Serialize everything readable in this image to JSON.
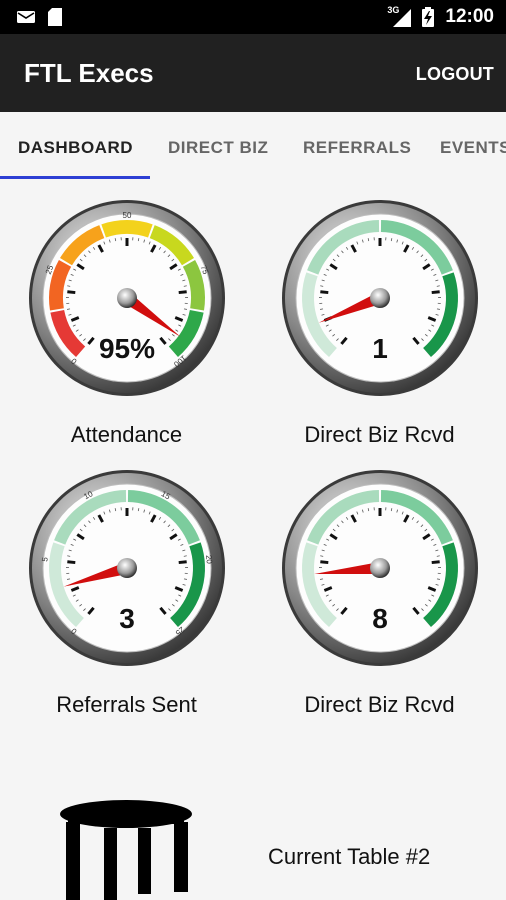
{
  "status_bar": {
    "time": "12:00",
    "network_label": "3G",
    "icons": [
      "email-icon",
      "sim-card-icon",
      "signal-icon",
      "battery-icon"
    ]
  },
  "app_bar": {
    "title": "FTL Execs",
    "logout_label": "LOGOUT"
  },
  "tabs": [
    {
      "label": "DASHBOARD",
      "active": true
    },
    {
      "label": "DIRECT BIZ",
      "active": false
    },
    {
      "label": "REFERRALS",
      "active": false
    },
    {
      "label": "EVENTS",
      "active": false
    }
  ],
  "gauges": [
    {
      "label": "Attendance",
      "value_text": "95%",
      "value": 95,
      "min": 0,
      "max": 100,
      "tick_labels": [
        "0",
        "25",
        "50",
        "75",
        "100"
      ],
      "scheme": "traffic",
      "colors": [
        "#e53935",
        "#f26522",
        "#f7a21b",
        "#f3d21c",
        "#c8d81e",
        "#8cc63f",
        "#2ea84a"
      ]
    },
    {
      "label": "Direct Biz Rcvd",
      "value_text": "1",
      "value": 1,
      "min": 0,
      "max": 10,
      "tick_labels": [],
      "scheme": "green",
      "colors": [
        "#cfe9d9",
        "#a9dbbd",
        "#7ccc9d",
        "#19964a"
      ]
    },
    {
      "label": "Referrals Sent",
      "value_text": "3",
      "value": 3,
      "min": 0,
      "max": 25,
      "tick_labels": [
        "0",
        "5",
        "10",
        "15",
        "20",
        "25"
      ],
      "scheme": "green",
      "colors": [
        "#cfe9d9",
        "#a9dbbd",
        "#7ccc9d",
        "#19964a"
      ]
    },
    {
      "label": "Direct Biz Rcvd",
      "value_text": "8",
      "value": 8,
      "min": 0,
      "max": 50,
      "tick_labels": [],
      "scheme": "green",
      "colors": [
        "#cfe9d9",
        "#a9dbbd",
        "#7ccc9d",
        "#19964a"
      ]
    }
  ],
  "current_table": {
    "label": "Current Table #2",
    "icon": "table-icon"
  }
}
